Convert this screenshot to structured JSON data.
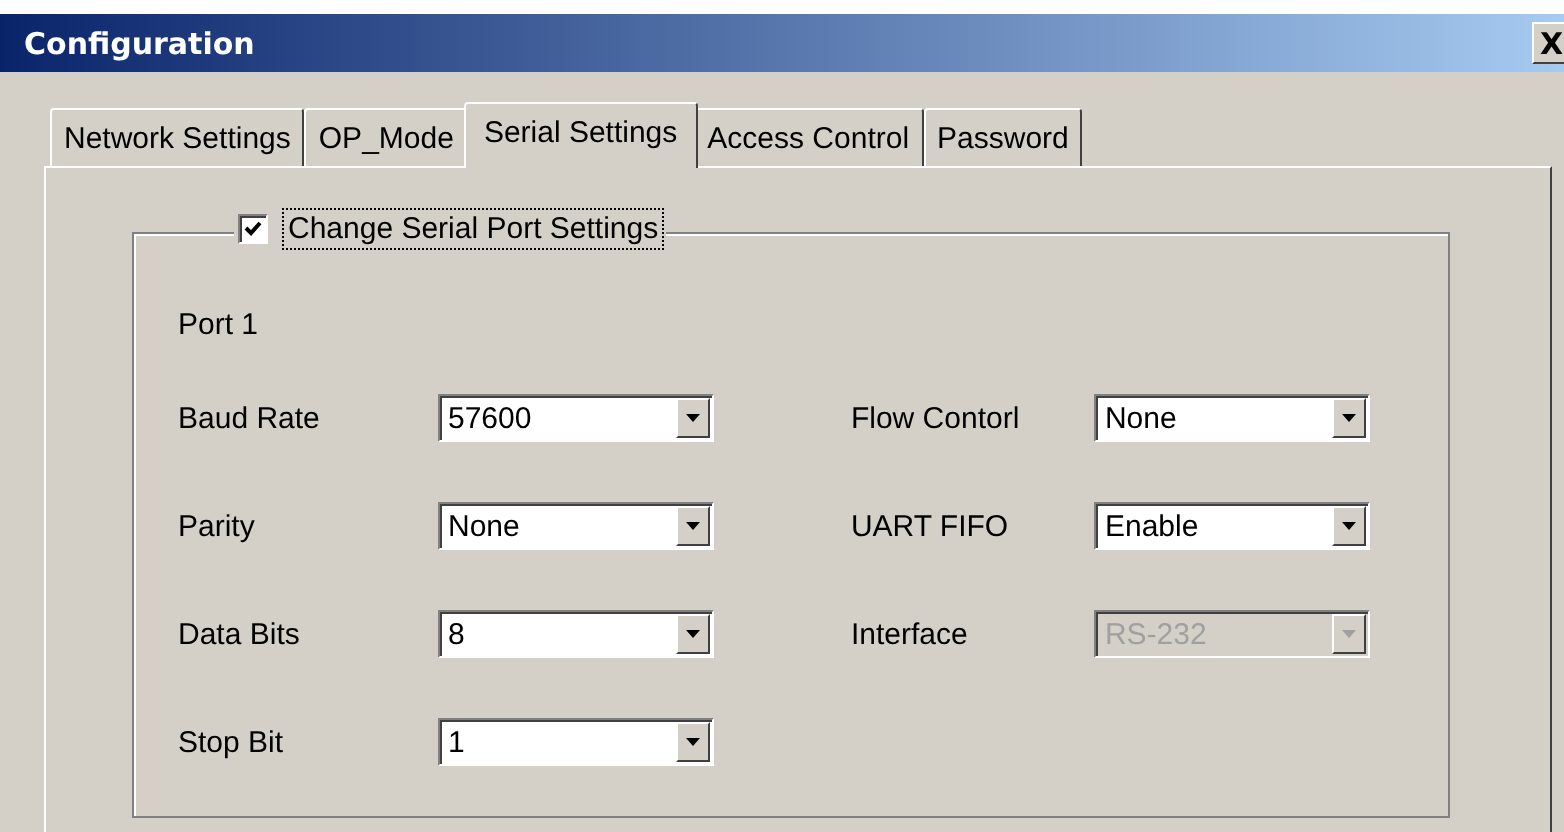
{
  "window": {
    "title": "Configuration",
    "close": "X"
  },
  "tabs": [
    {
      "label": "Network Settings",
      "selected": false
    },
    {
      "label": "OP_Mode",
      "selected": false
    },
    {
      "label": "Serial Settings",
      "selected": true
    },
    {
      "label": "Access Control",
      "selected": false
    },
    {
      "label": "Password",
      "selected": false
    }
  ],
  "group": {
    "label": "Change Serial Port Settings",
    "checked": true,
    "port": "Port 1",
    "left_fields": [
      {
        "label": "Baud Rate",
        "value": "57600",
        "disabled": false
      },
      {
        "label": "Parity",
        "value": "None",
        "disabled": false
      },
      {
        "label": "Data Bits",
        "value": "8",
        "disabled": false
      },
      {
        "label": "Stop Bit",
        "value": "1",
        "disabled": false
      }
    ],
    "right_fields": [
      {
        "label": "Flow Contorl",
        "value": "None",
        "disabled": false
      },
      {
        "label": "UART FIFO",
        "value": "Enable",
        "disabled": false
      },
      {
        "label": "Interface",
        "value": "RS-232",
        "disabled": true
      }
    ]
  }
}
